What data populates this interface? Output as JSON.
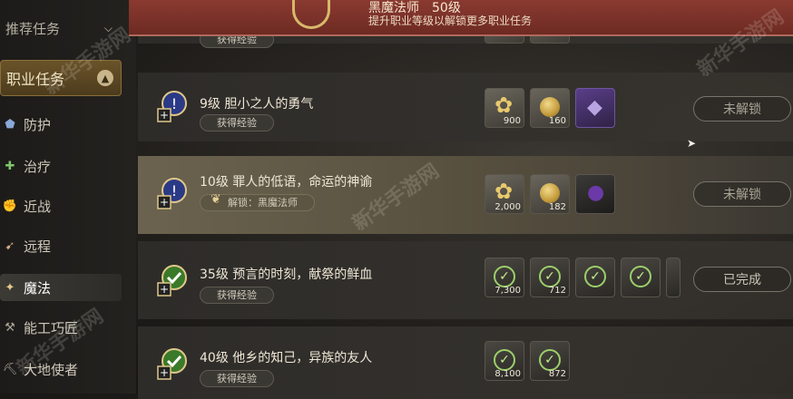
{
  "sidebar": {
    "recommended": {
      "label": "推荐任务",
      "icon": "chevron-down-icon"
    },
    "category": {
      "label": "职业任务",
      "icon": "chevron-up-icon"
    },
    "items": [
      {
        "label": "防护",
        "icon": "shield-icon"
      },
      {
        "label": "治疗",
        "icon": "cross-icon"
      },
      {
        "label": "近战",
        "icon": "fist-icon"
      },
      {
        "label": "远程",
        "icon": "arrow-icon"
      },
      {
        "label": "魔法",
        "icon": "wand-icon",
        "active": true
      },
      {
        "label": "能工巧匠",
        "icon": "hammer-icon"
      },
      {
        "label": "大地使者",
        "icon": "pickaxe-icon"
      }
    ]
  },
  "banner": {
    "title": "黑魔法师　50级",
    "subtitle": "提升职业等级以解锁更多职业任务"
  },
  "quests": [
    {
      "title": "",
      "tag": "获得经验",
      "partial": true
    },
    {
      "title": "9级 胆小之人的勇气",
      "tag": "获得经验",
      "status": "未解锁",
      "rewards": [
        {
          "type": "exp",
          "amount": "900"
        },
        {
          "type": "gold",
          "amount": "160"
        },
        {
          "type": "item-purple",
          "amount": ""
        }
      ]
    },
    {
      "title": "10级 罪人的低语，命运的神谕",
      "tag": "解锁：黑魔法师",
      "status": "未解锁",
      "highlighted": true,
      "rewards": [
        {
          "type": "exp",
          "amount": "2,000"
        },
        {
          "type": "gold",
          "amount": "182"
        },
        {
          "type": "item-dark",
          "amount": ""
        }
      ]
    },
    {
      "title": "35级 预言的时刻，献祭的鲜血",
      "tag": "获得经验",
      "status": "已完成",
      "rewards": [
        {
          "type": "done",
          "amount": "7,300"
        },
        {
          "type": "done",
          "amount": "712"
        },
        {
          "type": "done",
          "amount": ""
        },
        {
          "type": "done",
          "amount": ""
        },
        {
          "type": "done",
          "amount": ""
        }
      ]
    },
    {
      "title": "40级 他乡的知己，异族的友人",
      "tag": "获得经验",
      "status": "",
      "rewards": [
        {
          "type": "done",
          "amount": "8,100"
        },
        {
          "type": "done",
          "amount": "872"
        }
      ]
    }
  ],
  "watermark": "新华手游网",
  "colors": {
    "banner": "#7a3028",
    "accent_gold": "#d8b86a",
    "check_green": "#9ccf6a"
  }
}
